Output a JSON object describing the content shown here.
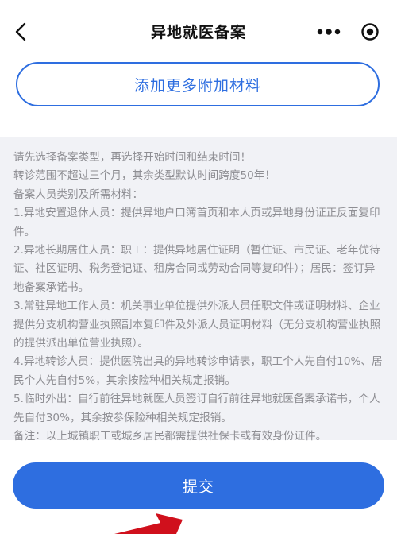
{
  "header": {
    "title": "异地就医备案",
    "icons": {
      "back": "chevron-left-icon",
      "more": "more-dots-icon",
      "target": "record-target-icon"
    }
  },
  "add_material_button": {
    "label": "添加更多附加材料"
  },
  "notes": {
    "paragraphs": [
      "请先选择备案类型，再选择开始时间和结束时间！",
      "转诊范围不超过三个月，其余类型默认时间跨度50年！",
      "备案人员类别及所需材料：",
      "1.异地安置退休人员：提供异地户口簿首页和本人页或异地身份证正反面复印件。",
      "2.异地长期居住人员：职工：提供异地居住证明（暂住证、市民证、老年优待证、社区证明、税务登记证、租房合同或劳动合同等复印件）；居民：签订异地备案承诺书。",
      "3.常驻异地工作人员：机关事业单位提供外派人员任职文件或证明材料、企业提供分支机构营业执照副本复印件及外派人员证明材料（无分支机构营业执照的提供派出单位营业执照）。",
      "4.异地转诊人员：提供医院出具的异地转诊申请表，职工个人先自付10%、居民个人先自付5%，其余按险种相关规定报销。",
      "5.临时外出：自行前往异地就医人员签订自行前往异地就医备案承诺书，个人先自付30%，其余按参保险种相关规定报销。",
      "备注：以上城镇职工或城乡居民都需提供社保卡或有效身份证件。"
    ]
  },
  "submit_button": {
    "label": "提交"
  },
  "colors": {
    "accent": "#2e6ee0",
    "notes_bg": "#f1f2f6",
    "notes_text": "#8e8e93",
    "annotation": "#d0101c"
  }
}
